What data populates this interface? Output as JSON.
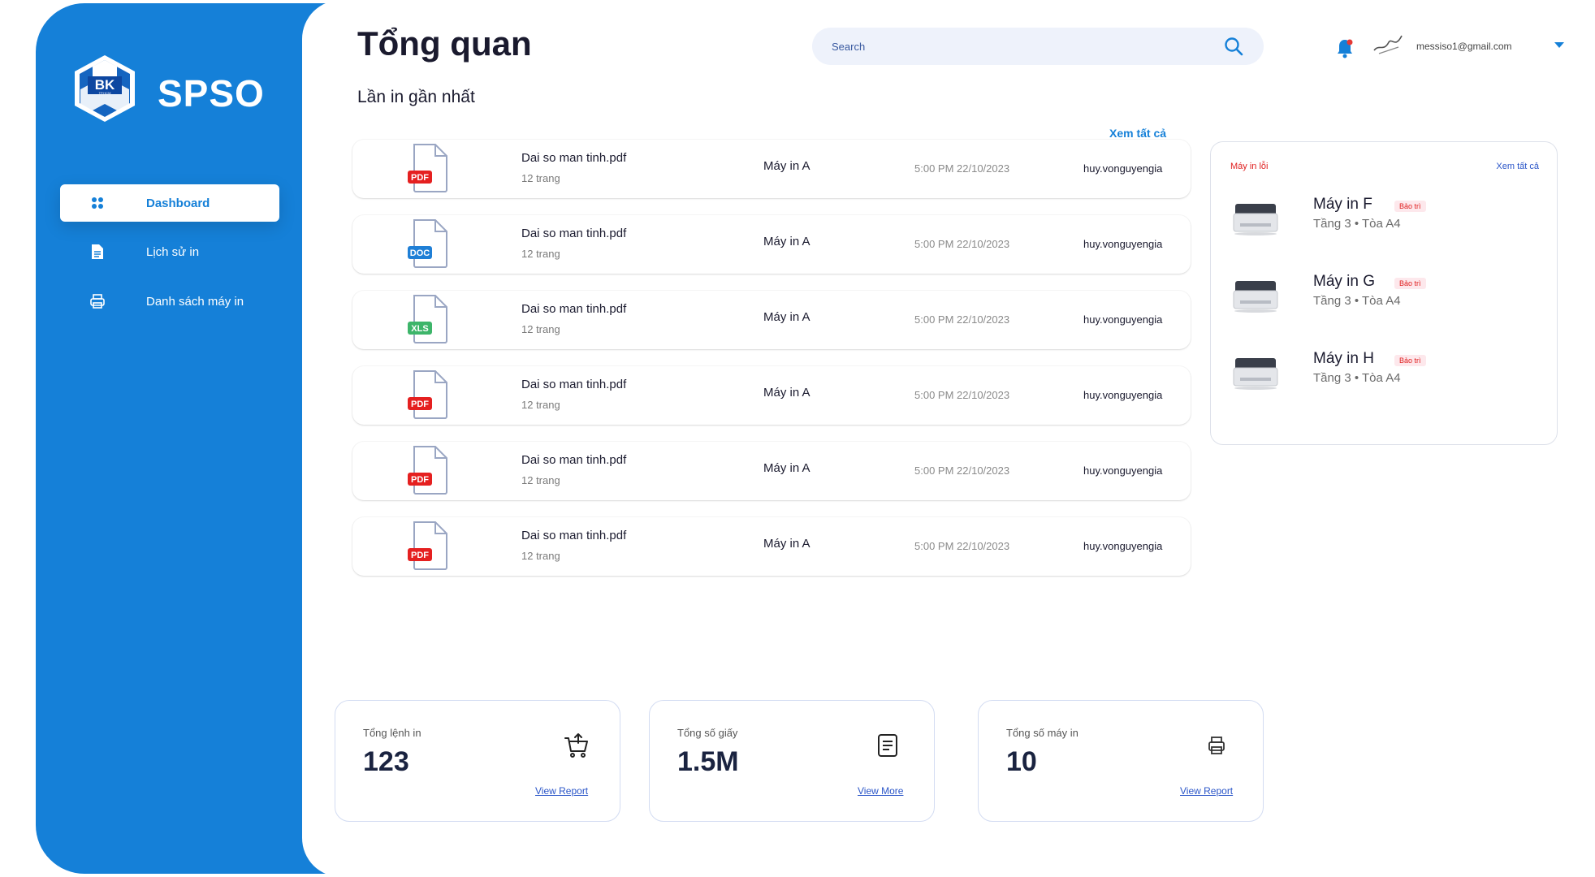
{
  "app": {
    "brand": "SPSO",
    "logo_text": "BK",
    "logo_subtext": "TP.HCM"
  },
  "sidebar": {
    "items": [
      {
        "label": "Dashboard",
        "icon": "dashboard-icon",
        "active": true
      },
      {
        "label": "Lịch sử in",
        "icon": "document-icon",
        "active": false
      },
      {
        "label": "Danh sách máy in",
        "icon": "printer-icon",
        "active": false
      }
    ]
  },
  "header": {
    "title": "Tổng quan",
    "search_placeholder": "Search",
    "user_email": "messiso1@gmail.com"
  },
  "recent": {
    "title": "Lần in gần nhất",
    "see_all": "Xem tất cả",
    "rows": [
      {
        "type": "PDF",
        "file": "Dai so man tinh.pdf",
        "pages": "12 trang",
        "printer": "Máy in A",
        "time": "5:00 PM 22/10/2023",
        "user": "huy.vonguyengia"
      },
      {
        "type": "DOC",
        "file": "Dai so man tinh.pdf",
        "pages": "12 trang",
        "printer": "Máy in A",
        "time": "5:00 PM 22/10/2023",
        "user": "huy.vonguyengia"
      },
      {
        "type": "XLS",
        "file": "Dai so man tinh.pdf",
        "pages": "12 trang",
        "printer": "Máy in A",
        "time": "5:00 PM 22/10/2023",
        "user": "huy.vonguyengia"
      },
      {
        "type": "PDF",
        "file": "Dai so man tinh.pdf",
        "pages": "12 trang",
        "printer": "Máy in A",
        "time": "5:00 PM 22/10/2023",
        "user": "huy.vonguyengia"
      },
      {
        "type": "PDF",
        "file": "Dai so man tinh.pdf",
        "pages": "12 trang",
        "printer": "Máy in A",
        "time": "5:00 PM 22/10/2023",
        "user": "huy.vonguyengia"
      },
      {
        "type": "PDF",
        "file": "Dai so man tinh.pdf",
        "pages": "12 trang",
        "printer": "Máy in A",
        "time": "5:00 PM 22/10/2023",
        "user": "huy.vonguyengia"
      }
    ]
  },
  "errors": {
    "title": "Máy in lỗi",
    "see_all": "Xem tất cả",
    "items": [
      {
        "name": "Máy in F",
        "badge": "Bảo trì",
        "location": "Tầng 3 • Tòa A4"
      },
      {
        "name": "Máy in G",
        "badge": "Bảo trì",
        "location": "Tầng 3 • Tòa A4"
      },
      {
        "name": "Máy in H",
        "badge": "Bảo trì",
        "location": "Tầng 3 • Tòa A4"
      }
    ]
  },
  "stats": [
    {
      "label": "Tổng lệnh in",
      "value": "123",
      "link": "View Report",
      "icon": "cart-icon"
    },
    {
      "label": "Tổng số giấy",
      "value": "1.5M",
      "link": "View More",
      "icon": "paper-icon"
    },
    {
      "label": "Tổng số máy in",
      "value": "10",
      "link": "View Report",
      "icon": "printer-icon"
    }
  ],
  "colors": {
    "primary": "#1580d8",
    "pdf": "#e52020",
    "doc": "#1f7fd6",
    "xls": "#3db56a",
    "error": "#e02020"
  }
}
